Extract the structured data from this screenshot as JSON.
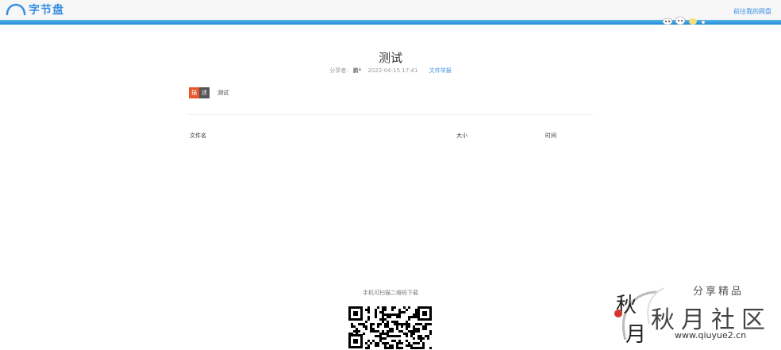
{
  "header": {
    "logo_text": "字节盘",
    "goto_link": "前往我的网盘"
  },
  "share": {
    "title": "测试",
    "sharer_label": "分享者:",
    "sharer_name": "鹏*",
    "datetime": "2022-04-15 17:41",
    "report_label": "文件举报"
  },
  "description": {
    "badge_left": "描",
    "badge_right": "述",
    "text": "测试"
  },
  "file_table": {
    "columns": [
      "文件名",
      "大小",
      "时间"
    ],
    "rows": []
  },
  "qr": {
    "caption": "手机可扫描二维码下载"
  },
  "watermark": {
    "share_text": "分享精品",
    "brand_text": "秋月社区",
    "url": "www.qiuyue2.cn"
  },
  "colors": {
    "accent": "#3a8fe0",
    "header_line": "#1e88d6",
    "badge_orange": "#e8572a",
    "badge_gray": "#555555"
  }
}
